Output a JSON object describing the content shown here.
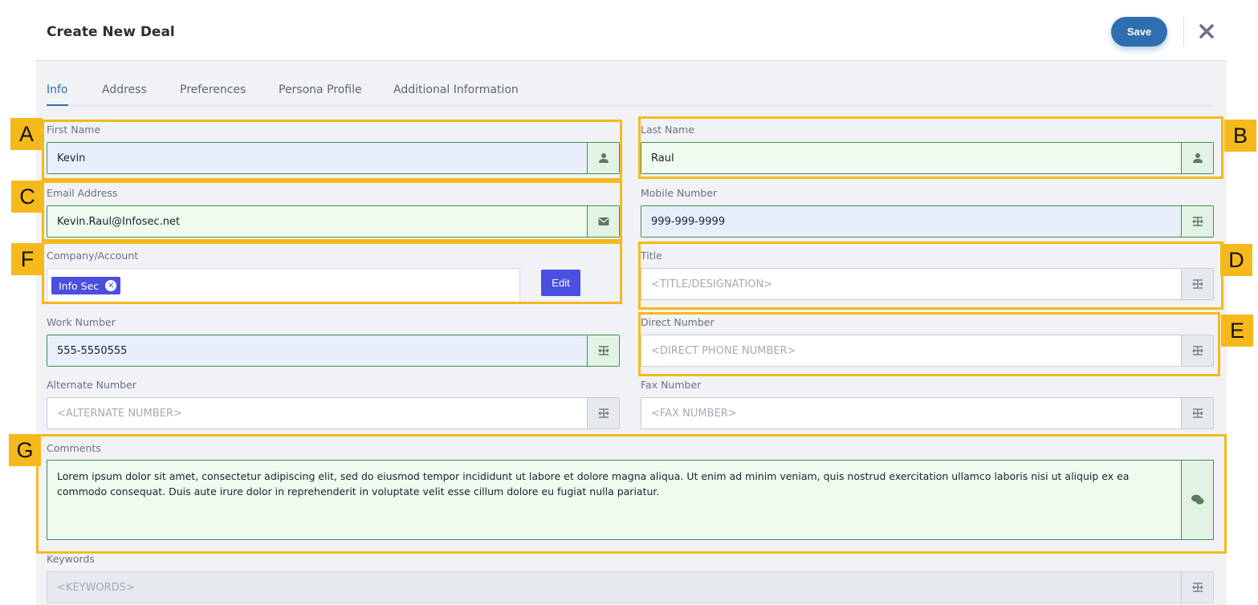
{
  "header": {
    "title": "Create New Deal",
    "save_label": "Save"
  },
  "tabs": [
    {
      "label": "Info"
    },
    {
      "label": "Address"
    },
    {
      "label": "Preferences"
    },
    {
      "label": "Persona Profile"
    },
    {
      "label": "Additional Information"
    }
  ],
  "fields": {
    "first_name": {
      "label": "First Name",
      "value": "Kevin"
    },
    "last_name": {
      "label": "Last Name",
      "value": "Raul"
    },
    "email": {
      "label": "Email Address",
      "value": "Kevin.Raul@Infosec.net"
    },
    "mobile": {
      "label": "Mobile Number",
      "value": "999-999-9999"
    },
    "company": {
      "label": "Company/Account",
      "chip": "Info Sec",
      "edit_label": "Edit"
    },
    "title": {
      "label": "Title",
      "placeholder": "<TITLE/DESIGNATION>"
    },
    "work": {
      "label": "Work Number",
      "value": "555-5550555"
    },
    "direct": {
      "label": "Direct Number",
      "placeholder": "<DIRECT PHONE NUMBER>"
    },
    "alternate": {
      "label": "Alternate Number",
      "placeholder": "<ALTERNATE NUMBER>"
    },
    "fax": {
      "label": "Fax Number",
      "placeholder": "<FAX NUMBER>"
    },
    "comments": {
      "label": "Comments",
      "value": "Lorem ipsum dolor sit amet, consectetur adipiscing elit, sed do eiusmod tempor incididunt ut labore et dolore magna aliqua. Ut enim ad minim veniam, quis nostrud exercitation ullamco laboris nisi ut aliquip ex ea commodo consequat. Duis aute irure dolor in reprehenderit in voluptate velit esse cillum dolore eu fugiat nulla pariatur."
    },
    "keywords": {
      "label": "Keywords",
      "placeholder": "<KEYWORDS>"
    }
  },
  "annotations": {
    "A": "A",
    "B": "B",
    "C": "C",
    "D": "D",
    "E": "E",
    "F": "F",
    "G": "G"
  },
  "colors": {
    "accent": "#2f6fb0",
    "chip": "#4a4fe0",
    "valid_green": "#3f9150",
    "annotation": "#f5b91c"
  }
}
